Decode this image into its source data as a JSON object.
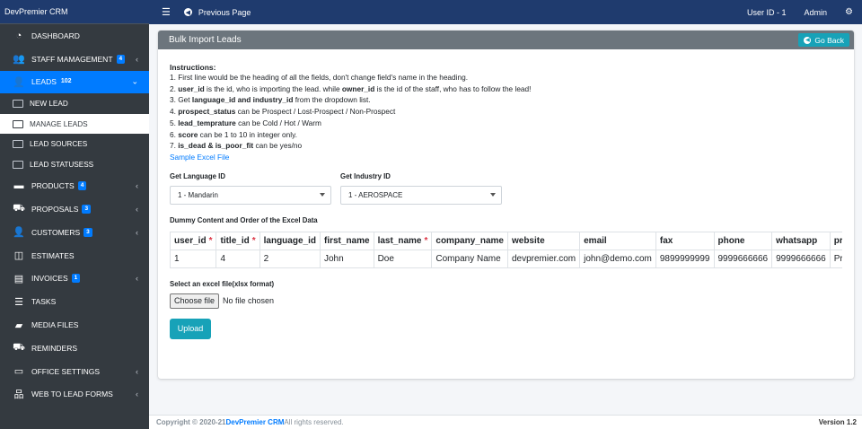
{
  "brand": "DevPremier CRM",
  "topbar": {
    "prev_page": "Previous Page",
    "user_id": "User ID - 1",
    "user_role": "Admin"
  },
  "sidebar": {
    "items": [
      {
        "label": "DASHBOARD",
        "icon": "dashboard-icon"
      },
      {
        "label": "STAFF MAMAGEMENT",
        "badge": "4",
        "icon": "users-icon"
      },
      {
        "label": "LEADS",
        "badge": "102",
        "icon": "user-group-icon"
      },
      {
        "label": "PRODUCTS",
        "badge": "4",
        "icon": "box-icon"
      },
      {
        "label": "PROPOSALS",
        "badge": "3",
        "icon": "truck-icon"
      },
      {
        "label": "CUSTOMERS",
        "badge": "3",
        "icon": "customers-icon"
      },
      {
        "label": "ESTIMATES",
        "icon": "columns-icon"
      },
      {
        "label": "INVOICES",
        "badge": "1",
        "icon": "invoice-icon"
      },
      {
        "label": "TASKS",
        "icon": "tasks-icon"
      },
      {
        "label": "MEDIA FILES",
        "icon": "folder-icon"
      },
      {
        "label": "REMINDERS",
        "icon": "reminder-icon"
      },
      {
        "label": "OFFICE SETTINGS",
        "icon": "settings-icon"
      },
      {
        "label": "WEB TO LEAD FORMS",
        "icon": "sitemap-icon"
      }
    ],
    "sub_items": [
      "NEW LEAD",
      "MANAGE LEADS",
      "LEAD SOURCES",
      "LEAD STATUSESS"
    ]
  },
  "card": {
    "title": "Bulk Import Leads",
    "go_back": "Go Back",
    "instructions_title": "Instructions:",
    "instructions": [
      {
        "pre": "1. First line would be the heading of all the fields, don't change field's name in the heading.",
        "b1": "",
        "mid": "",
        "b2": "",
        "post": ""
      },
      {
        "pre": "2. ",
        "b1": "user_id",
        "mid": " is the id, who is importing the lead. while ",
        "b2": "owner_id",
        "post": " is the id of the staff, who has to follow the lead!"
      },
      {
        "pre": "3. Get ",
        "b1": "language_id and industry_id",
        "mid": " from the dropdown list.",
        "b2": "",
        "post": ""
      },
      {
        "pre": "4. ",
        "b1": "prospect_status",
        "mid": " can be Prospect / Lost-Prospect / Non-Prospect",
        "b2": "",
        "post": ""
      },
      {
        "pre": "5. ",
        "b1": "lead_temprature",
        "mid": " can be Cold / Hot / Warm",
        "b2": "",
        "post": ""
      },
      {
        "pre": "6. ",
        "b1": "score",
        "mid": " can be 1 to 10 in integer only.",
        "b2": "",
        "post": ""
      },
      {
        "pre": "7. ",
        "b1": "is_dead & is_poor_fit",
        "mid": " can be yes/no",
        "b2": "",
        "post": ""
      }
    ],
    "sample_link": "Sample Excel File",
    "language_label": "Get Language ID",
    "language_value": "1 - Mandarin",
    "industry_label": "Get Industry ID",
    "industry_value": "1 - AEROSPACE",
    "dummy_title": "Dummy Content and Order of the Excel Data",
    "table": {
      "headers": [
        {
          "text": "user_id",
          "req": "*"
        },
        {
          "text": "title_id",
          "req": "*"
        },
        {
          "text": "language_id",
          "req": ""
        },
        {
          "text": "first_name",
          "req": ""
        },
        {
          "text": "last_name",
          "req": "*"
        },
        {
          "text": "company_name",
          "req": ""
        },
        {
          "text": "website",
          "req": ""
        },
        {
          "text": "email",
          "req": ""
        },
        {
          "text": "fax",
          "req": ""
        },
        {
          "text": "phone",
          "req": ""
        },
        {
          "text": "whatsapp",
          "req": ""
        },
        {
          "text": "pros",
          "req": ""
        }
      ],
      "row": [
        "1",
        "4",
        "2",
        "John",
        "Doe",
        "Company Name",
        "devpremier.com",
        "john@demo.com",
        "9899999999",
        "9999666666",
        "9999666666",
        "Pros"
      ]
    },
    "file_label": "Select an excel file(xlsx format)",
    "choose_file": "Choose file",
    "no_file": "No file chosen",
    "upload": "Upload"
  },
  "footer": {
    "copyright": "Copyright © 2020-21 ",
    "brand": "DevPremier CRM",
    "rights": " All rights reserved.",
    "version": "Version 1.2"
  }
}
